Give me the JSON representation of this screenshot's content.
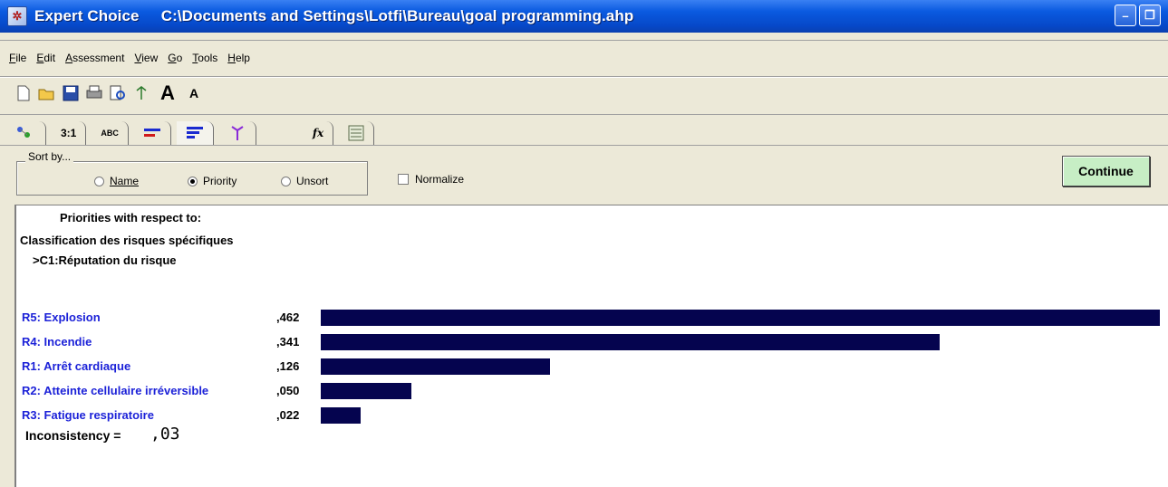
{
  "window": {
    "title": "Expert Choice     C:\\Documents and Settings\\Lotfi\\Bureau\\goal programming.ahp"
  },
  "menu": [
    "File",
    "Edit",
    "Assessment",
    "View",
    "Go",
    "Tools",
    "Help"
  ],
  "toolbar": [
    "new-icon",
    "open-icon",
    "save-icon",
    "print-icon",
    "print-preview-icon",
    "tree-icon",
    "font-larger-icon",
    "font-smaller-icon"
  ],
  "tabs": {
    "pairwise": "3:1",
    "verbal": "ABC",
    "formula": "fx"
  },
  "sort": {
    "legend": "Sort by...",
    "options": [
      "Name",
      "Priority",
      "Unsort"
    ],
    "selected": "Priority"
  },
  "normalize": {
    "label": "Normalize",
    "checked": false
  },
  "continue_label": "Continue",
  "priorities": {
    "heading": "Priorities with respect to:",
    "goal": "Classification des risques spécifiques",
    "node": ">C1:Réputation du risque"
  },
  "chart_data": {
    "type": "bar",
    "categories": [
      "R5: Explosion",
      "R4: Incendie",
      "R1: Arrêt cardiaque",
      "R2: Atteinte cellulaire irréversible",
      "R3: Fatigue respiratoire"
    ],
    "values": [
      0.462,
      0.341,
      0.126,
      0.05,
      0.022
    ],
    "value_labels": [
      ",462",
      ",341",
      ",126",
      ",050",
      ",022"
    ],
    "bar_color": "#05044f"
  },
  "inconsistency": {
    "label": "Inconsistency =",
    "value": ",03"
  }
}
